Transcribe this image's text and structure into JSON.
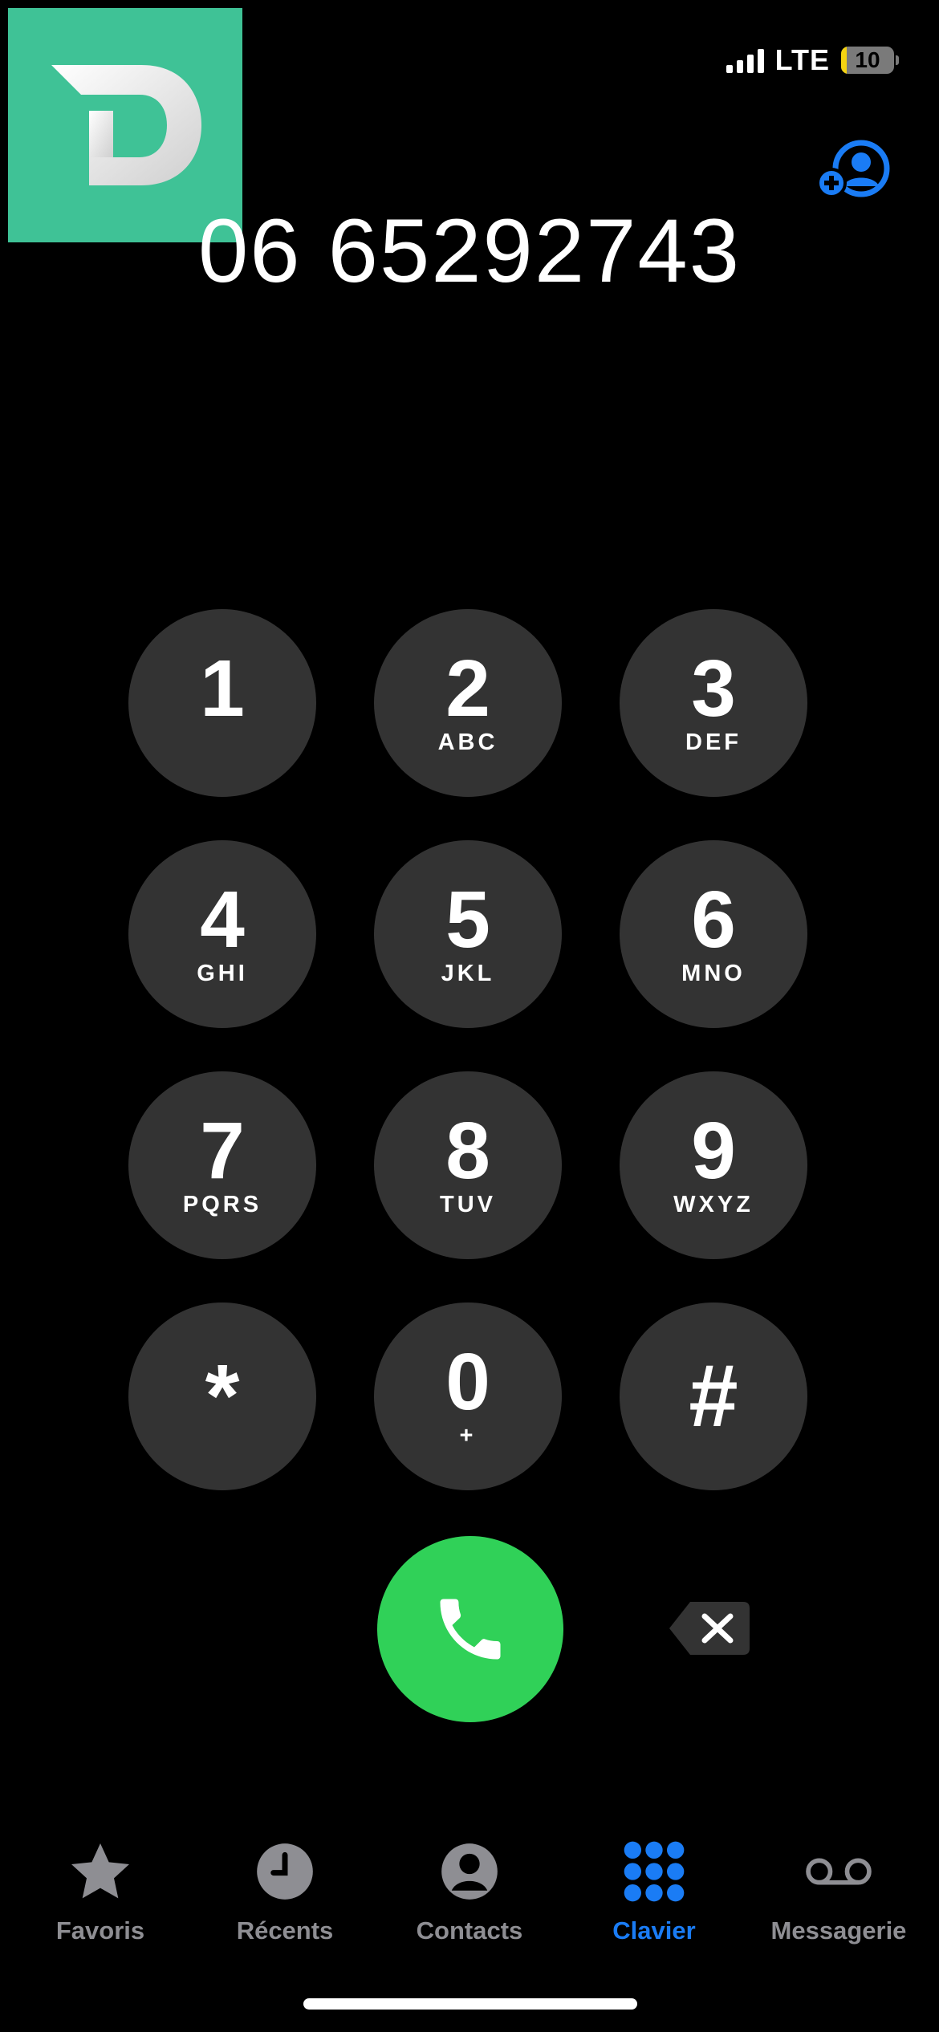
{
  "status_bar": {
    "network": "LTE",
    "battery_level": "10",
    "battery_fraction": 0.1
  },
  "dialer": {
    "number": "06 65292743"
  },
  "keypad": [
    {
      "digit": "1",
      "letters": ""
    },
    {
      "digit": "2",
      "letters": "ABC"
    },
    {
      "digit": "3",
      "letters": "DEF"
    },
    {
      "digit": "4",
      "letters": "GHI"
    },
    {
      "digit": "5",
      "letters": "JKL"
    },
    {
      "digit": "6",
      "letters": "MNO"
    },
    {
      "digit": "7",
      "letters": "PQRS"
    },
    {
      "digit": "8",
      "letters": "TUV"
    },
    {
      "digit": "9",
      "letters": "WXYZ"
    },
    {
      "digit": "*",
      "letters": ""
    },
    {
      "digit": "0",
      "letters": "+"
    },
    {
      "digit": "#",
      "letters": ""
    }
  ],
  "tabbar": [
    {
      "label": "Favoris",
      "icon": "star-icon",
      "active": false
    },
    {
      "label": "Récents",
      "icon": "clock-icon",
      "active": false
    },
    {
      "label": "Contacts",
      "icon": "person-icon",
      "active": false
    },
    {
      "label": "Clavier",
      "icon": "keypad-icon",
      "active": true
    },
    {
      "label": "Messagerie",
      "icon": "voicemail-icon",
      "active": false
    }
  ],
  "colors": {
    "background": "#000000",
    "key": "#333333",
    "call": "#30d158",
    "accent": "#1a7cf5",
    "inactive": "#8e8e93",
    "logo": "#3fc296"
  }
}
